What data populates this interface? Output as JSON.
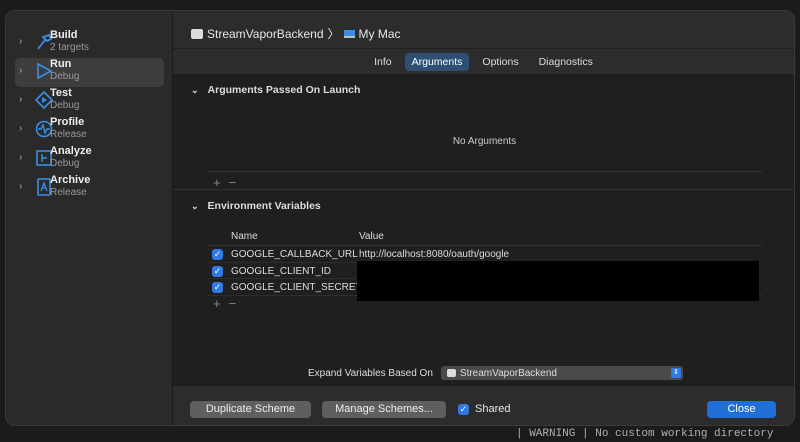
{
  "background_text": "| WARNING | No custom working directory",
  "sidebar": {
    "items": [
      {
        "label": "Build",
        "sub": "2 targets",
        "icon": "hammer-icon"
      },
      {
        "label": "Run",
        "sub": "Debug",
        "icon": "play-icon",
        "selected": true
      },
      {
        "label": "Test",
        "sub": "Debug",
        "icon": "test-icon"
      },
      {
        "label": "Profile",
        "sub": "Release",
        "icon": "profile-icon"
      },
      {
        "label": "Analyze",
        "sub": "Debug",
        "icon": "analyze-icon"
      },
      {
        "label": "Archive",
        "sub": "Release",
        "icon": "archive-icon"
      }
    ]
  },
  "header": {
    "scheme": "StreamVaporBackend",
    "separator": "〉",
    "destination": "My Mac"
  },
  "tabs": [
    {
      "label": "Info"
    },
    {
      "label": "Arguments",
      "selected": true
    },
    {
      "label": "Options"
    },
    {
      "label": "Diagnostics"
    }
  ],
  "arguments": {
    "title": "Arguments Passed On Launch",
    "empty": "No Arguments",
    "add": "+",
    "remove": "−"
  },
  "env": {
    "title": "Environment Variables",
    "col_name": "Name",
    "col_value": "Value",
    "add": "+",
    "remove": "−",
    "rows": [
      {
        "name": "GOOGLE_CALLBACK_URL",
        "value": "http://localhost:8080/oauth/google",
        "checked": true
      },
      {
        "name": "GOOGLE_CLIENT_ID",
        "value": "",
        "checked": true
      },
      {
        "name": "GOOGLE_CLIENT_SECRET",
        "value": "",
        "checked": true
      }
    ]
  },
  "expand": {
    "label": "Expand Variables Based On",
    "value": "StreamVaporBackend"
  },
  "footer": {
    "duplicate": "Duplicate Scheme",
    "manage": "Manage Schemes...",
    "shared": "Shared",
    "close": "Close"
  },
  "colors": {
    "accent": "#1f6fd6",
    "tab_selected": "#2e5074",
    "icon": "#3b8ee8"
  }
}
